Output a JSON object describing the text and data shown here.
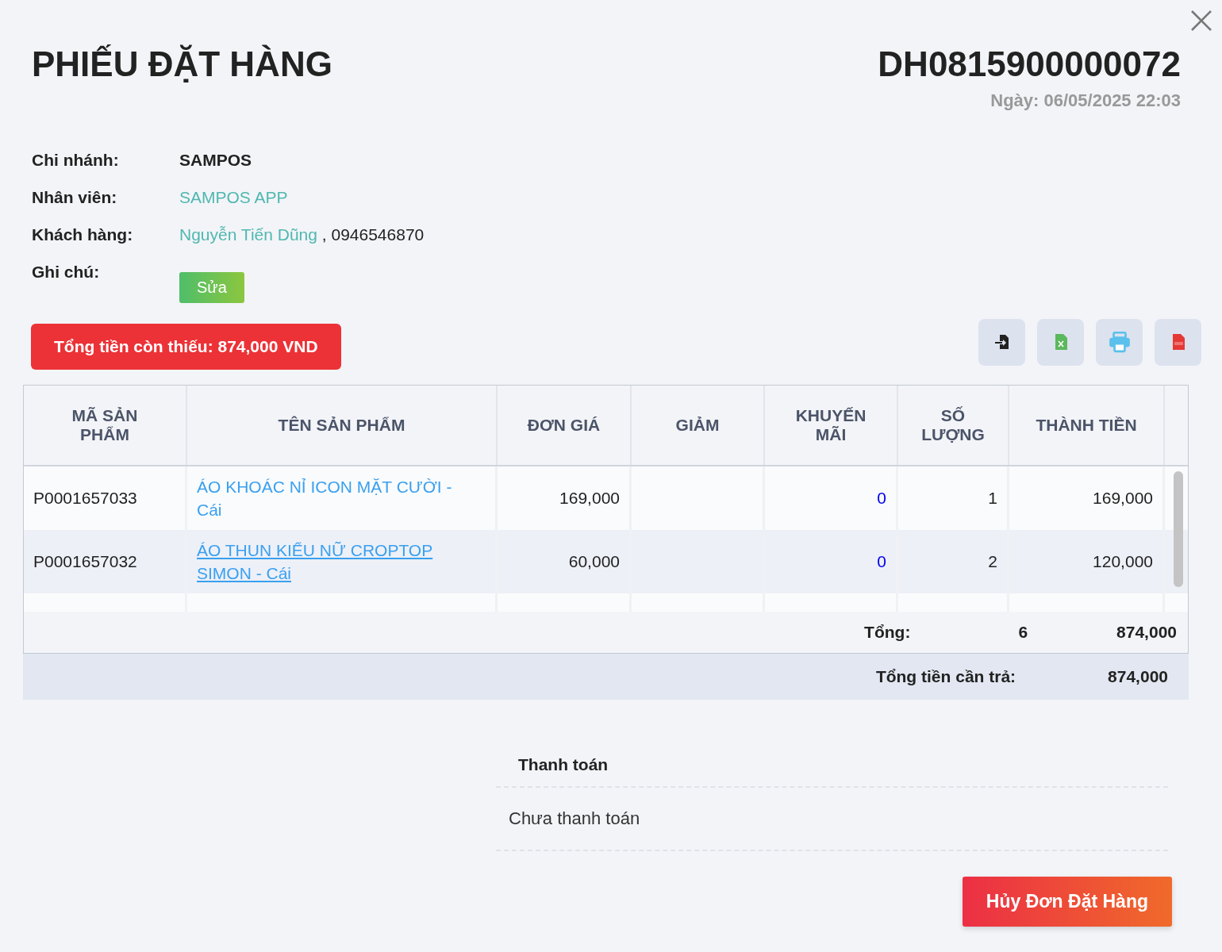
{
  "title": "PHIẾU ĐẶT HÀNG",
  "order_code": "DH0815900000072",
  "date": "Ngày: 06/05/2025 22:03",
  "branch": {
    "label": "Chi nhánh:",
    "value": "SAMPOS"
  },
  "staff": {
    "label": "Nhân viên:",
    "value": "SAMPOS APP"
  },
  "customer": {
    "label": "Khách hàng:",
    "name": "Nguyễn Tiến Dũng",
    "phone": ", 0946546870"
  },
  "note": {
    "label": "Ghi chú:",
    "button": "Sửa"
  },
  "outstanding": "Tổng tiền còn thiếu: 874,000 VND",
  "table": {
    "columns": [
      "MÃ SẢN PHẨM",
      "TÊN SẢN PHẨM",
      "ĐƠN GIÁ",
      "GIẢM",
      "KHUYẾN MÃI",
      "SỐ LƯỢNG",
      "THÀNH TIỀN"
    ],
    "rows": [
      {
        "code": "P0001657033",
        "name": "ÁO KHOÁC NỈ ICON MẶT CƯỜI - Cái",
        "hovered": false,
        "price": "169,000",
        "promo": "0",
        "qty": "1",
        "total": "169,000"
      },
      {
        "code": "P0001657032",
        "name": "ÁO THUN KIỂU NỮ CROPTOP SIMON - Cái",
        "hovered": true,
        "price": "60,000",
        "promo": "0",
        "qty": "2",
        "total": "120,000"
      }
    ],
    "sum": {
      "label": "Tổng:",
      "qty": "6",
      "amount": "874,000"
    },
    "grand": {
      "label": "Tổng tiền cần trả:",
      "amount": "874,000"
    }
  },
  "payment": {
    "heading": "Thanh toán",
    "status": "Chưa thanh toán"
  },
  "cancel_button": "Hủy Đơn Đặt Hàng"
}
